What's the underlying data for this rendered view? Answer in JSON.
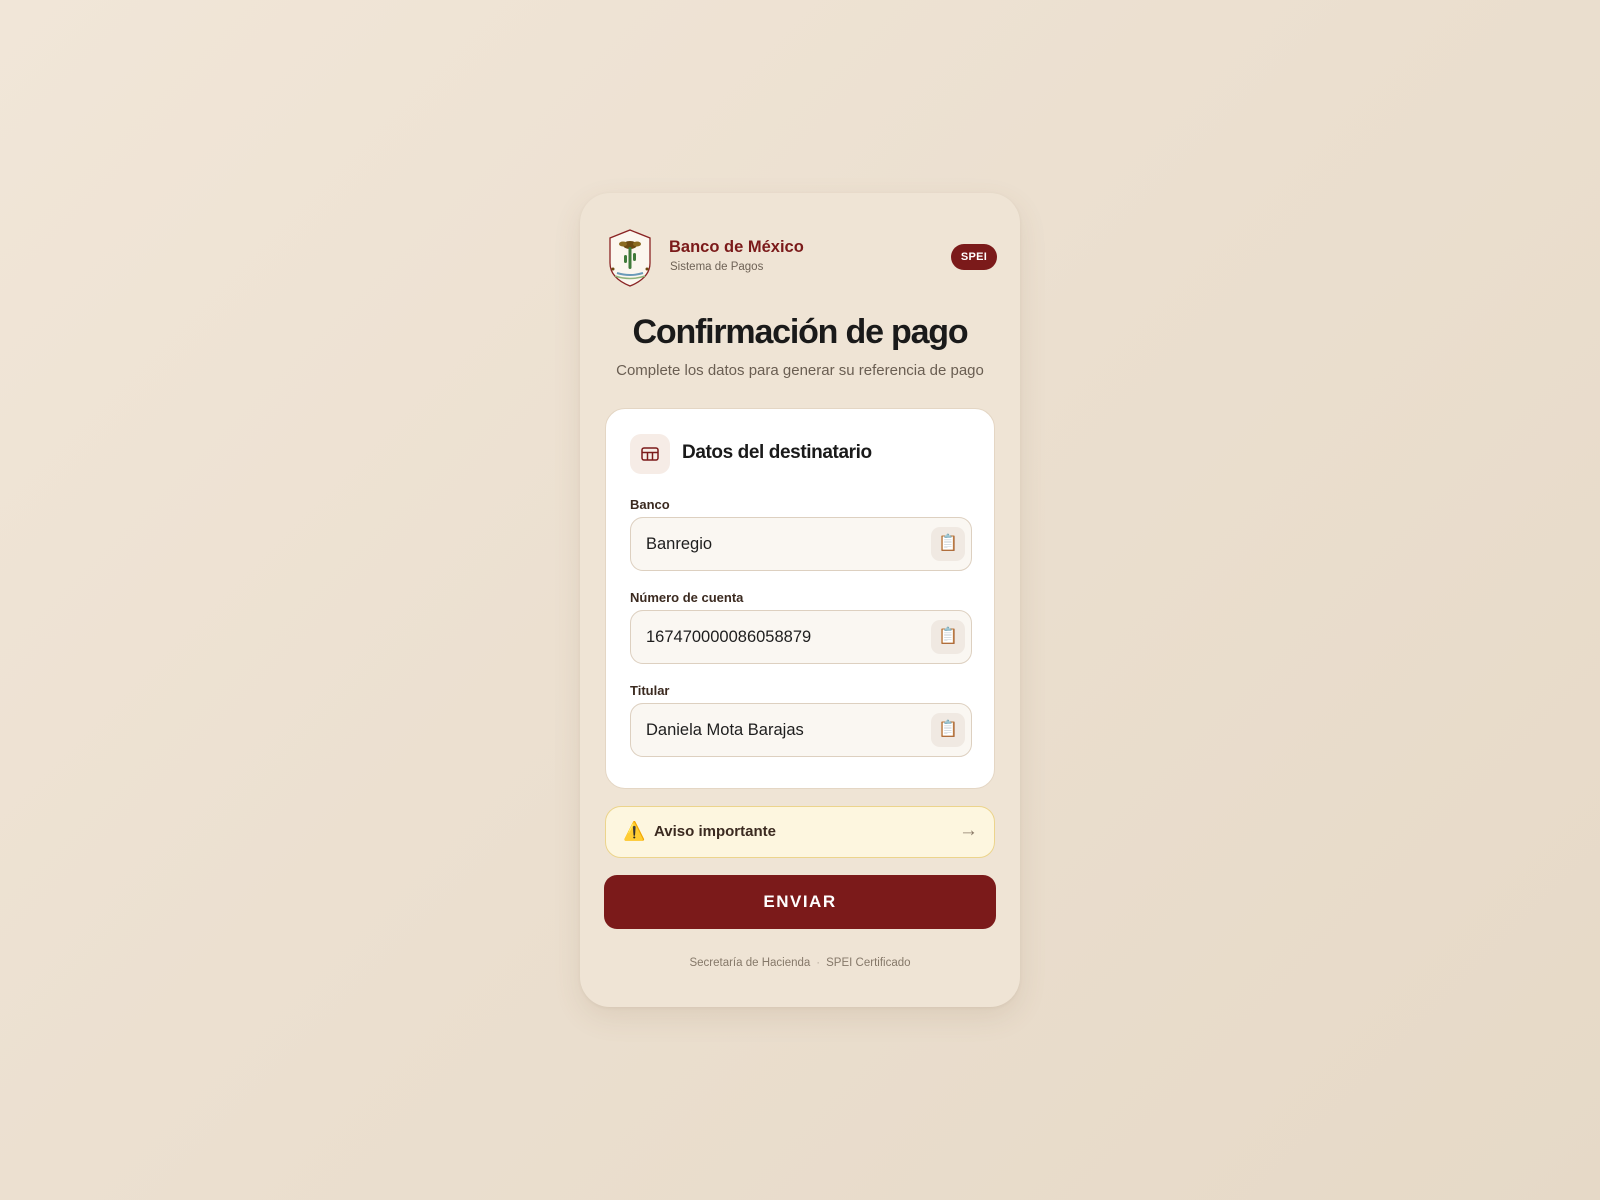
{
  "header": {
    "brand_name": "Banco de México",
    "brand_sub": "Sistema de Pagos",
    "badge": "SPEI"
  },
  "main": {
    "title": "Confirmación de pago",
    "subtitle": "Complete los datos para generar su referencia de pago"
  },
  "recipient": {
    "title": "Datos del destinatario",
    "icon": "bank-card-icon",
    "fields": [
      {
        "label": "Banco",
        "value": "Banregio",
        "icon": "clipboard-icon"
      },
      {
        "label": "Número de cuenta",
        "value": "167470000086058879",
        "icon": "clipboard-icon"
      },
      {
        "label": "Titular",
        "value": "Daniela Mota Barajas",
        "icon": "clipboard-icon"
      }
    ]
  },
  "notice": {
    "icon": "warning-icon",
    "text": "Aviso importante",
    "arrow": "→"
  },
  "actions": {
    "submit_label": "ENVIAR"
  },
  "footer": {
    "left": "Secretaría de Hacienda",
    "separator": "·",
    "right": "SPEI Certificado"
  },
  "colors": {
    "brand": "#7b1a1a",
    "background": "#efe4d5",
    "notice_bg": "#fdf6df"
  }
}
